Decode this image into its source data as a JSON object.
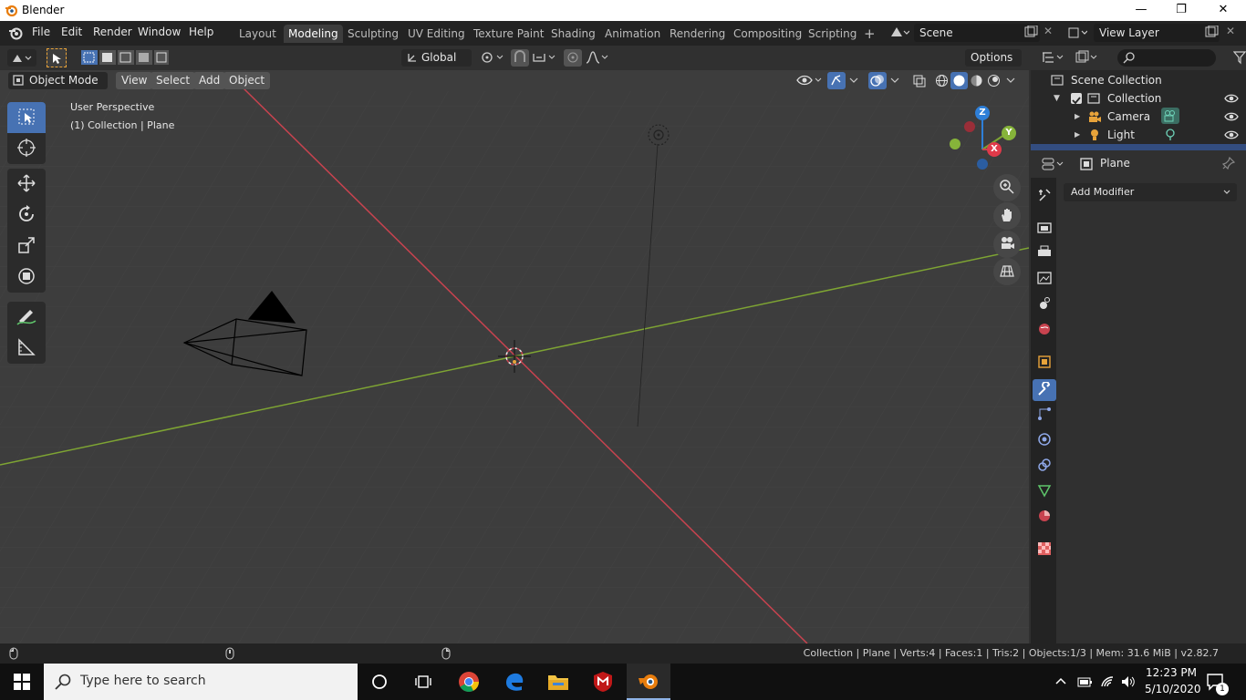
{
  "window": {
    "title": "Blender",
    "minimize": "—",
    "restore": "❐",
    "close": "✕"
  },
  "menus": [
    "File",
    "Edit",
    "Render",
    "Window",
    "Help"
  ],
  "workspaces": [
    "Layout",
    "Modeling",
    "Sculpting",
    "UV Editing",
    "Texture Paint",
    "Shading",
    "Animation",
    "Rendering",
    "Compositing",
    "Scripting"
  ],
  "active_workspace": "Modeling",
  "add_workspace": "+",
  "scene": {
    "name": "Scene"
  },
  "view_layer": {
    "name": "View Layer"
  },
  "tool_header": {
    "orientation": "Global",
    "options": "Options"
  },
  "viewport_header": {
    "mode": "Object Mode",
    "menus": [
      "View",
      "Select",
      "Add",
      "Object"
    ]
  },
  "viewport_overlay": {
    "perspective": "User Perspective",
    "context": "(1) Collection | Plane"
  },
  "gizmo": {
    "z": "Z",
    "y": "Y",
    "x": "X"
  },
  "outliner": {
    "root": "Scene Collection",
    "collection": "Collection",
    "items": [
      {
        "name": "Camera",
        "icon": "camera-icon"
      },
      {
        "name": "Light",
        "icon": "light-icon"
      }
    ]
  },
  "properties": {
    "object_name": "Plane",
    "add_modifier": "Add Modifier"
  },
  "status_bar": {
    "text": "Collection | Plane | Verts:4 | Faces:1 | Tris:2 | Objects:1/3 | Mem: 31.6 MiB | v2.82.7"
  },
  "taskbar": {
    "search_placeholder": "Type here to search",
    "time": "12:23 PM",
    "date": "5/10/2020",
    "notifications": "1"
  },
  "colors": {
    "accent": "#4772b3",
    "x_axis": "#c8434f",
    "y_axis": "#7ea433",
    "z_axis": "#2e7fd8",
    "viewport_bg": "#3d3d3d"
  }
}
